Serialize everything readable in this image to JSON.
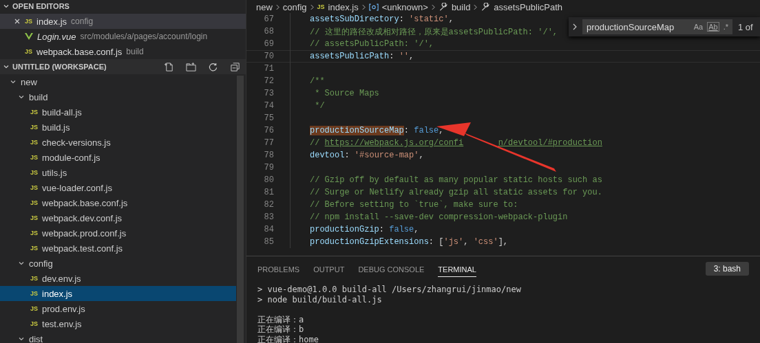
{
  "open_editors": {
    "title": "OPEN EDITORS",
    "expanded": true,
    "items": [
      {
        "name": "index.js",
        "description": "config",
        "kind": "js",
        "badge": "JS",
        "selected": true,
        "preview": false
      },
      {
        "name": "Login.vue",
        "description": "src/modules/a/pages/account/login",
        "kind": "vue",
        "selected": false,
        "preview": true
      },
      {
        "name": "webpack.base.conf.js",
        "description": "build",
        "kind": "js",
        "badge": "JS",
        "selected": false,
        "preview": false
      }
    ]
  },
  "workspace": {
    "title": "UNTITLED (WORKSPACE)",
    "expanded": true,
    "tree": [
      {
        "name": "new",
        "kind": "folder",
        "expanded": true,
        "selected": false,
        "children": [
          {
            "name": "build",
            "kind": "folder",
            "expanded": true,
            "selected": false,
            "children": [
              {
                "name": "build-all.js",
                "kind": "js",
                "badge": "JS",
                "selected": false
              },
              {
                "name": "build.js",
                "kind": "js",
                "badge": "JS",
                "selected": false
              },
              {
                "name": "check-versions.js",
                "kind": "js",
                "badge": "JS",
                "selected": false
              },
              {
                "name": "module-conf.js",
                "kind": "js",
                "badge": "JS",
                "selected": false
              },
              {
                "name": "utils.js",
                "kind": "js",
                "badge": "JS",
                "selected": false
              },
              {
                "name": "vue-loader.conf.js",
                "kind": "js",
                "badge": "JS",
                "selected": false
              },
              {
                "name": "webpack.base.conf.js",
                "kind": "js",
                "badge": "JS",
                "selected": false
              },
              {
                "name": "webpack.dev.conf.js",
                "kind": "js",
                "badge": "JS",
                "selected": false
              },
              {
                "name": "webpack.prod.conf.js",
                "kind": "js",
                "badge": "JS",
                "selected": false
              },
              {
                "name": "webpack.test.conf.js",
                "kind": "js",
                "badge": "JS",
                "selected": false
              }
            ]
          },
          {
            "name": "config",
            "kind": "folder",
            "expanded": true,
            "selected": false,
            "children": [
              {
                "name": "dev.env.js",
                "kind": "js",
                "badge": "JS",
                "selected": false
              },
              {
                "name": "index.js",
                "kind": "js",
                "badge": "JS",
                "selected": true
              },
              {
                "name": "prod.env.js",
                "kind": "js",
                "badge": "JS",
                "selected": false
              },
              {
                "name": "test.env.js",
                "kind": "js",
                "badge": "JS",
                "selected": false
              }
            ]
          },
          {
            "name": "dist",
            "kind": "folder",
            "expanded": true,
            "selected": false
          }
        ]
      }
    ]
  },
  "breadcrumb": [
    {
      "label": "new",
      "kind": "folder"
    },
    {
      "label": "config",
      "kind": "folder"
    },
    {
      "label": "index.js",
      "kind": "js",
      "badge": "JS"
    },
    {
      "label": "<unknown>",
      "kind": "symbol"
    },
    {
      "label": "build",
      "kind": "property"
    },
    {
      "label": "assetsPublicPath",
      "kind": "property"
    }
  ],
  "find_widget": {
    "value": "productionSourceMap",
    "options": [
      "Aa",
      "Ab",
      ".*"
    ],
    "count": "1 of"
  },
  "code": [
    {
      "number": "67",
      "current": false,
      "tokens": [
        {
          "kind": "key",
          "text": "assetsSubDirectory"
        },
        {
          "kind": "punct",
          "text": ": "
        },
        {
          "kind": "string",
          "text": "'static'"
        },
        {
          "kind": "punct",
          "text": ","
        }
      ]
    },
    {
      "number": "68",
      "current": false,
      "tokens": [
        {
          "kind": "comment",
          "text": "// 这里的路径改成相对路径，原来是assetsPublicPath: '/',"
        }
      ]
    },
    {
      "number": "69",
      "current": false,
      "tokens": [
        {
          "kind": "comment",
          "text": "// assetsPublicPath: '/',"
        }
      ]
    },
    {
      "number": "70",
      "current": true,
      "tokens": [
        {
          "kind": "key",
          "text": "assetsPublicPath"
        },
        {
          "kind": "punct",
          "text": ": "
        },
        {
          "kind": "string",
          "text": "''"
        },
        {
          "kind": "punct",
          "text": ","
        }
      ]
    },
    {
      "number": "71",
      "current": false
    },
    {
      "number": "72",
      "current": false,
      "tokens": [
        {
          "kind": "comment",
          "text": "/**"
        }
      ]
    },
    {
      "number": "73",
      "current": false,
      "tokens": [
        {
          "kind": "comment",
          "text": " * Source Maps"
        }
      ]
    },
    {
      "number": "74",
      "current": false,
      "tokens": [
        {
          "kind": "comment",
          "text": " */"
        }
      ]
    },
    {
      "number": "75",
      "current": false
    },
    {
      "number": "76",
      "current": false,
      "tokens": [
        {
          "kind": "match",
          "text": "productionSourceMap"
        },
        {
          "kind": "punct",
          "text": ": "
        },
        {
          "kind": "bool",
          "text": "false"
        },
        {
          "kind": "punct",
          "text": ","
        }
      ]
    },
    {
      "number": "77",
      "current": false,
      "tokens": [
        {
          "kind": "comment",
          "text": "// "
        },
        {
          "kind": "link",
          "text": "https://webpack.js.org/confi"
        },
        {
          "kind": "link",
          "text": "n/devtool/#production"
        }
      ]
    },
    {
      "number": "78",
      "current": false,
      "tokens": [
        {
          "kind": "key",
          "text": "devtool"
        },
        {
          "kind": "punct",
          "text": ": "
        },
        {
          "kind": "string",
          "text": "'#source-map'"
        },
        {
          "kind": "punct",
          "text": ","
        }
      ]
    },
    {
      "number": "79",
      "current": false
    },
    {
      "number": "80",
      "current": false,
      "tokens": [
        {
          "kind": "comment",
          "text": "// Gzip off by default as many popular static hosts such as"
        }
      ]
    },
    {
      "number": "81",
      "current": false,
      "tokens": [
        {
          "kind": "comment",
          "text": "// Surge or Netlify already gzip all static assets for you."
        }
      ]
    },
    {
      "number": "82",
      "current": false,
      "tokens": [
        {
          "kind": "comment",
          "text": "// Before setting to `true`, make sure to:"
        }
      ]
    },
    {
      "number": "83",
      "current": false,
      "tokens": [
        {
          "kind": "comment",
          "text": "// npm install --save-dev compression-webpack-plugin"
        }
      ]
    },
    {
      "number": "84",
      "current": false,
      "tokens": [
        {
          "kind": "key",
          "text": "productionGzip"
        },
        {
          "kind": "punct",
          "text": ": "
        },
        {
          "kind": "bool",
          "text": "false"
        },
        {
          "kind": "punct",
          "text": ","
        }
      ]
    },
    {
      "number": "85",
      "current": false,
      "tokens": [
        {
          "kind": "key",
          "text": "productionGzipExtensions"
        },
        {
          "kind": "punct",
          "text": ": ["
        },
        {
          "kind": "string",
          "text": "'js'"
        },
        {
          "kind": "punct",
          "text": ", "
        },
        {
          "kind": "string",
          "text": "'css'"
        },
        {
          "kind": "punct",
          "text": "],"
        }
      ]
    }
  ],
  "panel": {
    "tabs": [
      {
        "label": "PROBLEMS",
        "selected": false
      },
      {
        "label": "OUTPUT",
        "selected": false
      },
      {
        "label": "DEBUG CONSOLE",
        "selected": false
      },
      {
        "label": "TERMINAL",
        "selected": true
      }
    ],
    "terminal_select": "3: bash",
    "terminal_blocks": [
      [
        "> vue-demo@1.0.0 build-all /Users/zhangrui/jinmao/new",
        "> node build/build-all.js"
      ],
      [
        "正在编译：a",
        "正在编译：b",
        "正在编译：home"
      ]
    ]
  }
}
